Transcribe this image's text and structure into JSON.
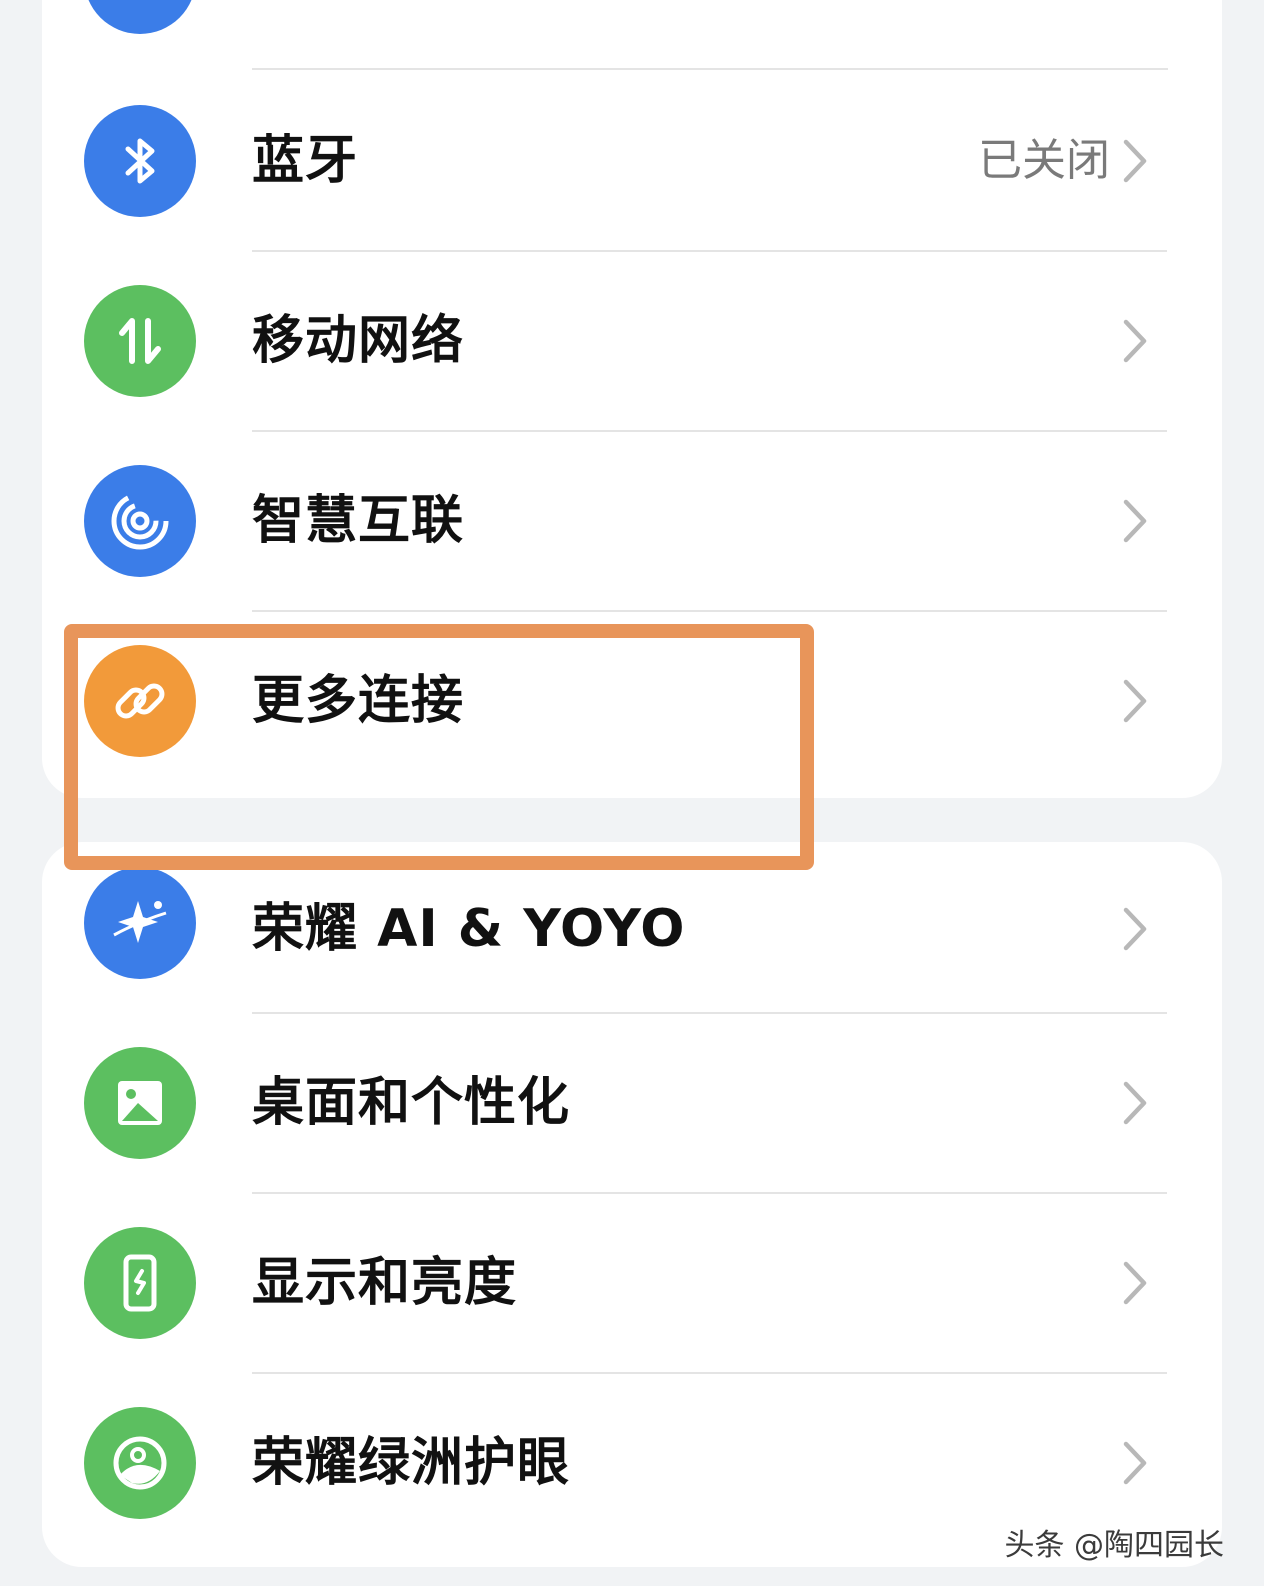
{
  "colors": {
    "blue": "#3b7de8",
    "green": "#5cbf60",
    "orange": "#f29a3a",
    "highlight": "#e8955a"
  },
  "top_partial": {
    "label": "",
    "value": ""
  },
  "group1": [
    {
      "label": "蓝牙",
      "value": "已关闭",
      "icon": "bluetooth-icon",
      "color": "#3b7de8"
    },
    {
      "label": "移动网络",
      "value": "",
      "icon": "mobile-data-icon",
      "color": "#5cbf60"
    },
    {
      "label": "智慧互联",
      "value": "",
      "icon": "smart-connect-icon",
      "color": "#3b7de8"
    },
    {
      "label": "更多连接",
      "value": "",
      "icon": "link-icon",
      "color": "#f29a3a"
    }
  ],
  "group2": [
    {
      "label": "荣耀 AI & YOYO",
      "value": "",
      "icon": "ai-sparkle-icon",
      "color": "#3b7de8"
    },
    {
      "label": "桌面和个性化",
      "value": "",
      "icon": "wallpaper-icon",
      "color": "#5cbf60"
    },
    {
      "label": "显示和亮度",
      "value": "",
      "icon": "display-brightness-icon",
      "color": "#5cbf60"
    },
    {
      "label": "荣耀绿洲护眼",
      "value": "",
      "icon": "eye-comfort-icon",
      "color": "#5cbf60"
    }
  ],
  "watermark": "头条 @陶四园长"
}
